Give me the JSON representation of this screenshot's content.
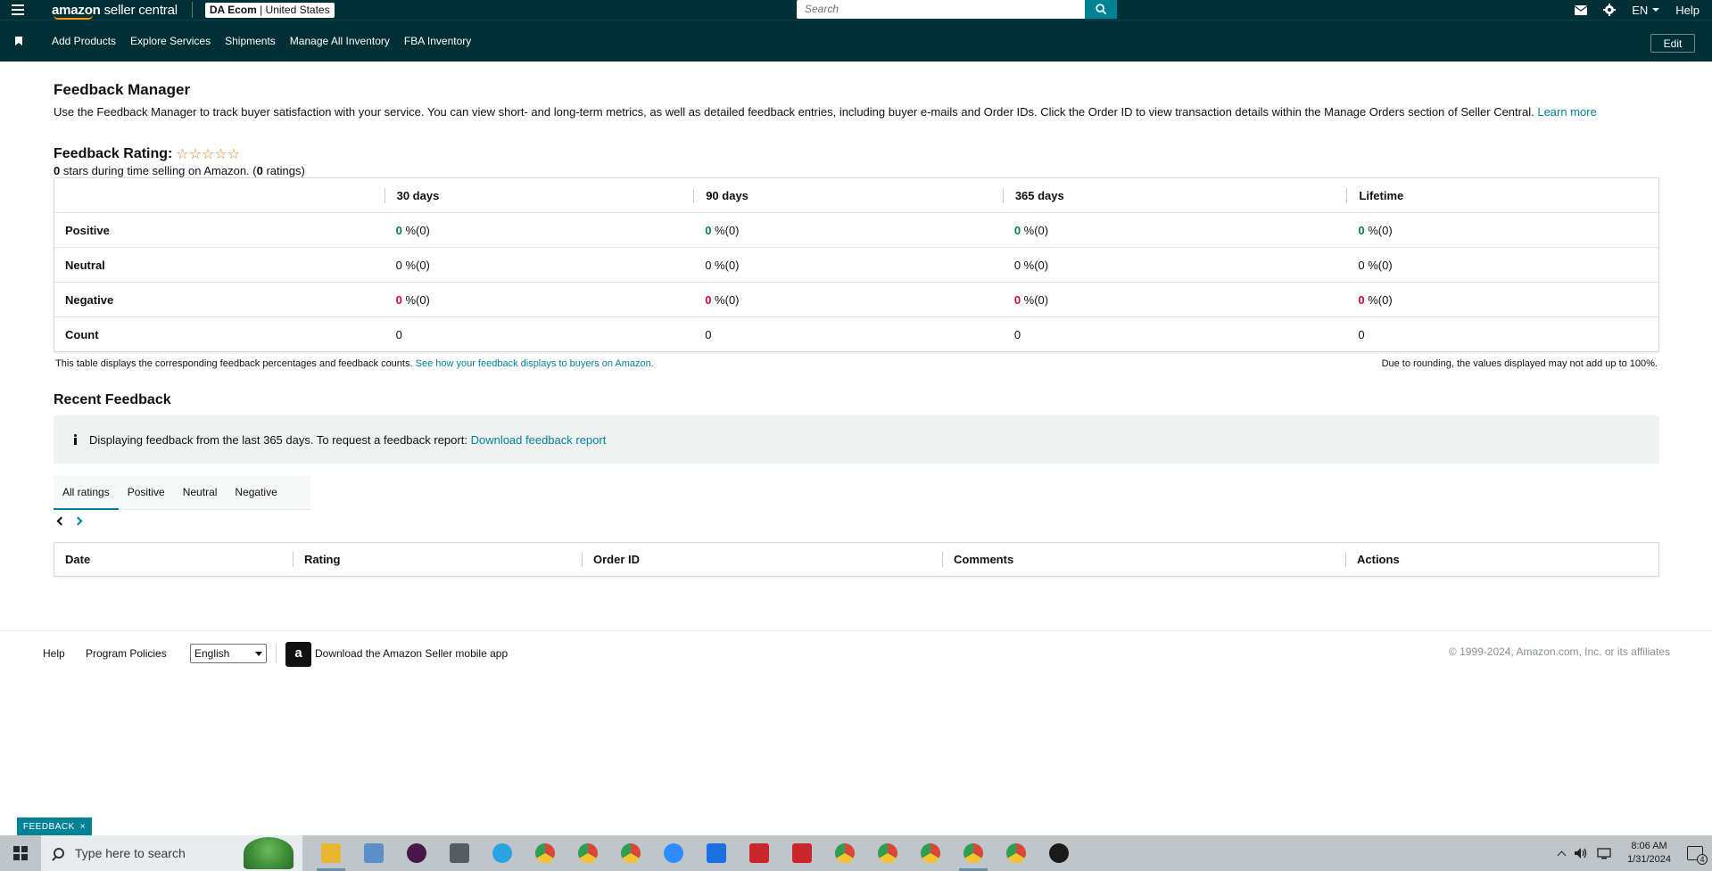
{
  "topbar": {
    "logo_bold": "amazon",
    "logo_light": " seller central",
    "account_name": "DA Ecom",
    "account_region": " | United States",
    "search_placeholder": "Search",
    "language": "EN",
    "help": "Help"
  },
  "navbar": {
    "items": [
      "Add Products",
      "Explore Services",
      "Shipments",
      "Manage All Inventory",
      "FBA Inventory"
    ],
    "edit": "Edit"
  },
  "page": {
    "title": "Feedback Manager",
    "intro": "Use the Feedback Manager to track buyer satisfaction with your service. You can view short- and long-term metrics, as well as detailed feedback entries, including buyer e-mails and Order IDs. Click the Order ID to view transaction details within the Manage Orders section of Seller Central.",
    "learn_more": "Learn more",
    "rating_label": "Feedback Rating:",
    "stars": "☆☆☆☆☆",
    "rating_sub_count": "0",
    "rating_sub_text": " stars during time selling on Amazon. (",
    "rating_sub_ratings": "0",
    "rating_sub_end": " ratings)"
  },
  "feedback_table": {
    "headers": [
      "30 days",
      "90 days",
      "365 days",
      "Lifetime"
    ],
    "rows": [
      {
        "label": "Positive",
        "values": [
          "0",
          "0",
          "0",
          "0"
        ],
        "suffix": " %(0)",
        "color": "#067d62"
      },
      {
        "label": "Neutral",
        "values": [
          "0",
          "0",
          "0",
          "0"
        ],
        "suffix": " %(0)",
        "color": "#0f1111"
      },
      {
        "label": "Negative",
        "values": [
          "0",
          "0",
          "0",
          "0"
        ],
        "suffix": " %(0)",
        "color": "#cc0c39"
      },
      {
        "label": "Count",
        "values": [
          "0",
          "0",
          "0",
          "0"
        ],
        "suffix": "",
        "color": "#0f1111"
      }
    ],
    "note": "This table displays the corresponding feedback percentages and feedback counts.",
    "note_link": "See how your feedback displays to buyers on Amazon.",
    "note_right": "Due to rounding, the values displayed may not add up to 100%."
  },
  "recent": {
    "title": "Recent Feedback",
    "info": "Displaying feedback from the last 365 days. To request a feedback report:",
    "info_link": "Download feedback report",
    "tabs": [
      "All ratings",
      "Positive",
      "Neutral",
      "Negative"
    ],
    "columns": [
      "Date",
      "Rating",
      "Order ID",
      "Comments",
      "Actions"
    ]
  },
  "footer": {
    "help": "Help",
    "policies": "Program Policies",
    "language_select": "English",
    "app_text": "Download the Amazon Seller mobile app",
    "copyright": "© 1999-2024, Amazon.com, Inc. or its affiliates"
  },
  "feedback_tab": {
    "label": "FEEDBACK",
    "close": "×"
  },
  "taskbar": {
    "search_placeholder": "Type here to search",
    "time": "8:06 AM",
    "date": "1/31/2024",
    "notifications": "4",
    "apps": [
      {
        "icon": "file-explorer-icon",
        "color": "#e9b634"
      },
      {
        "icon": "notepad-icon",
        "color": "#5a8fc7"
      },
      {
        "icon": "slack-icon",
        "color": "#4a154b"
      },
      {
        "icon": "calculator-icon",
        "color": "#555d63"
      },
      {
        "icon": "telegram-icon",
        "color": "#2aa4e0"
      },
      {
        "icon": "chrome-icon",
        "color": "#d9473a"
      },
      {
        "icon": "chrome-icon",
        "color": "#d9473a"
      },
      {
        "icon": "chrome-icon",
        "color": "#d9473a"
      },
      {
        "icon": "zoom-icon",
        "color": "#2d8cff"
      },
      {
        "icon": "rebrandly-icon",
        "color": "#1b6fe0"
      },
      {
        "icon": "chart-app-icon",
        "color": "#c8262b"
      },
      {
        "icon": "chart-app-icon",
        "color": "#c8262b"
      },
      {
        "icon": "chrome-icon",
        "color": "#d9473a"
      },
      {
        "icon": "chrome-icon",
        "color": "#d9473a"
      },
      {
        "icon": "chrome-icon",
        "color": "#d9473a"
      },
      {
        "icon": "chrome-icon",
        "color": "#d9473a"
      },
      {
        "icon": "chrome-icon",
        "color": "#d9473a"
      },
      {
        "icon": "record-icon",
        "color": "#1a1a1a"
      }
    ]
  },
  "colors": {
    "header_bg": "#002f36",
    "accent": "#008296",
    "positive": "#067d62",
    "negative": "#cc0c39",
    "star": "#de7921"
  }
}
